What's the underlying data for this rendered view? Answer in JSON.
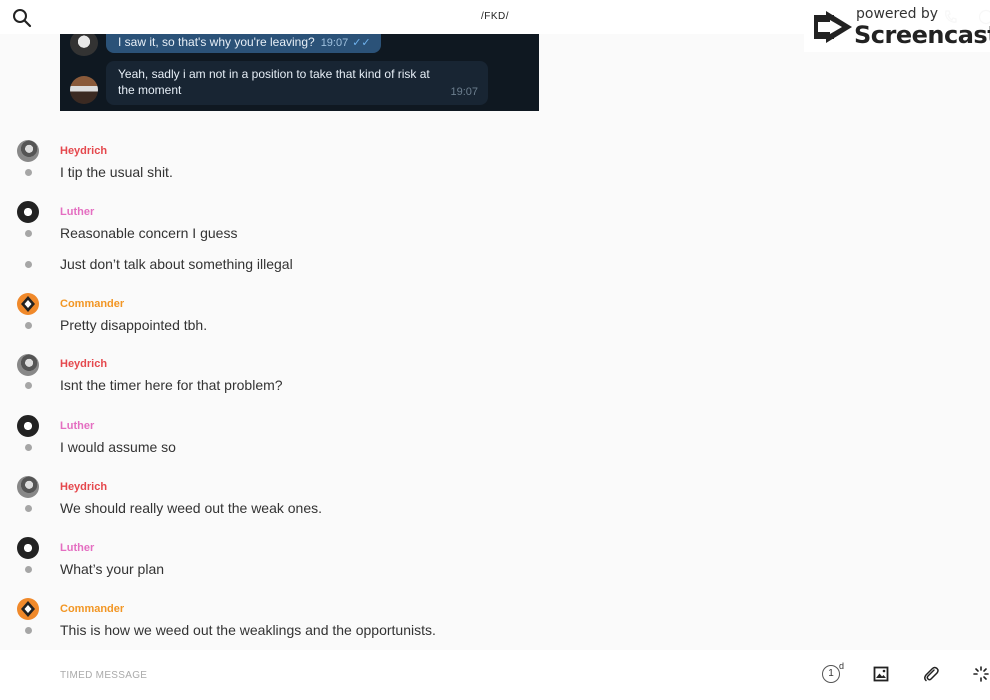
{
  "header": {
    "title": "/FKD/"
  },
  "watermark": {
    "powered": "powered by",
    "brand": "Screencastify"
  },
  "embedded_screenshot": {
    "bubble1": {
      "text": "I saw it, so that's why you're leaving?",
      "time": "19:07"
    },
    "bubble2": {
      "text": "Yeah, sadly i am not in a position to take that kind of risk at the moment",
      "time": "19:07"
    }
  },
  "messages": [
    {
      "sender": "Heydrich",
      "text": "I tip the usual shit."
    },
    {
      "sender": "Luther",
      "text": "Reasonable concern I guess"
    },
    {
      "sender": "",
      "text": "Just don’t talk about something illegal"
    },
    {
      "sender": "Commander",
      "text": "Pretty disappointed tbh."
    },
    {
      "sender": "Heydrich",
      "text": "Isnt the timer here for that problem?"
    },
    {
      "sender": "Luther",
      "text": "I would assume so"
    },
    {
      "sender": "Heydrich",
      "text": "We should really weed out the weak ones."
    },
    {
      "sender": "Luther",
      "text": "What’s your plan"
    },
    {
      "sender": "Commander",
      "text": "This is how we weed out the weaklings and the opportunists."
    }
  ],
  "composer": {
    "placeholder": "TIMED MESSAGE",
    "timer_value": "1",
    "timer_unit": "d"
  },
  "colors": {
    "heydrich": "#e5484d",
    "luther": "#e46ec1",
    "commander": "#f29624"
  }
}
